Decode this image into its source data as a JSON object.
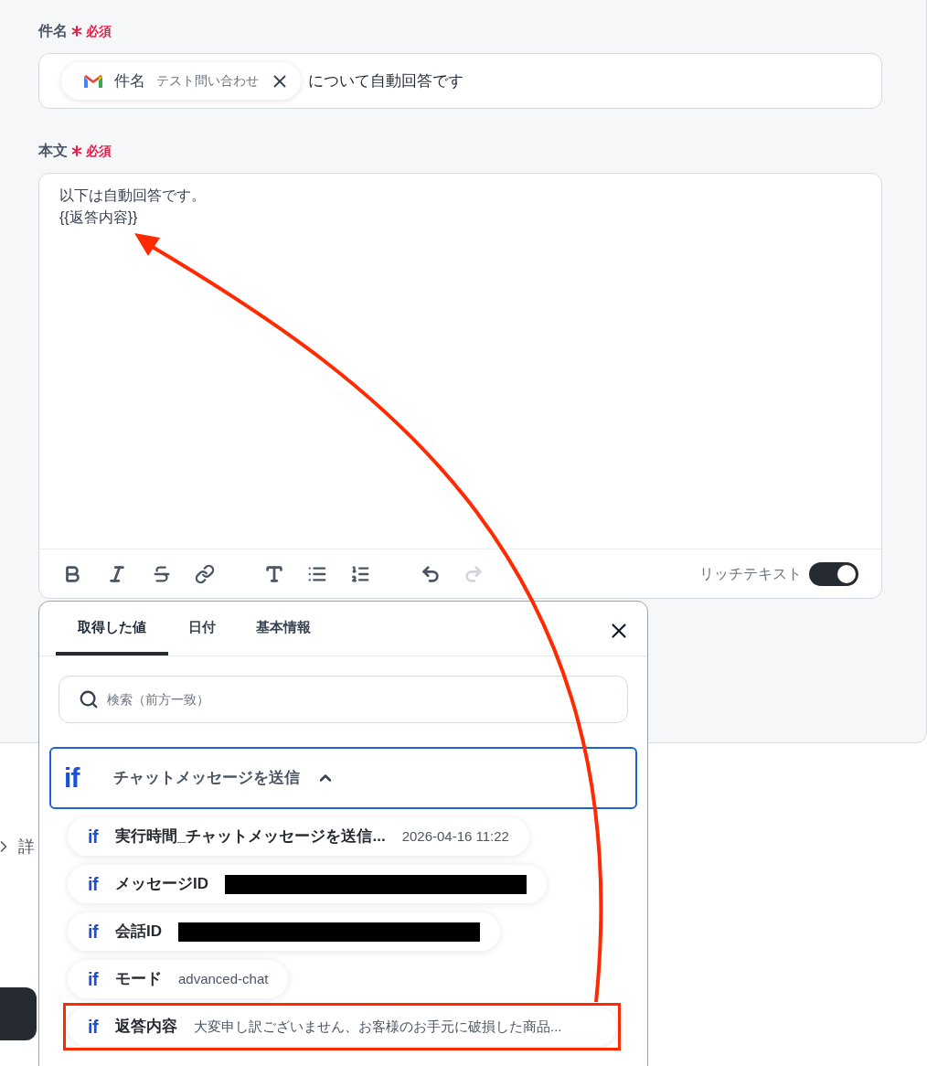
{
  "subject": {
    "label": "件名",
    "required": "必須",
    "chip": {
      "name": "件名",
      "value": "テスト問い合わせ"
    },
    "text": "について自動回答です"
  },
  "body": {
    "label": "本文",
    "required": "必須",
    "lines": [
      "以下は自動回答です。",
      "{{返答内容}}"
    ],
    "redo_disabled": true,
    "rich_text": {
      "label": "リッチテキスト",
      "on": true
    }
  },
  "details_label": "詳",
  "picker": {
    "tabs": [
      {
        "label": "取得した値",
        "selected": true
      },
      {
        "label": "日付",
        "selected": false
      },
      {
        "label": "基本情報",
        "selected": false
      }
    ],
    "search": {
      "placeholder": "検索（前方一致）"
    },
    "group": {
      "mark": "if",
      "title": "チャットメッセージを送信",
      "expanded": true
    },
    "items": [
      {
        "mark": "if",
        "name": "実行時間_チャットメッセージを送信...",
        "kind": "text",
        "value": "2026-04-16 11:22",
        "highlighted": false
      },
      {
        "mark": "if",
        "name": "メッセージID",
        "kind": "redacted",
        "highlighted": false
      },
      {
        "mark": "if",
        "name": "会話ID",
        "kind": "redacted",
        "highlighted": false
      },
      {
        "mark": "if",
        "name": "モード",
        "kind": "text",
        "value": "advanced-chat",
        "highlighted": false
      },
      {
        "mark": "if",
        "name": "返答内容",
        "kind": "text",
        "value": "大変申し訳ございません、お客様のお手元に破損した商品...",
        "highlighted": true
      }
    ]
  }
}
